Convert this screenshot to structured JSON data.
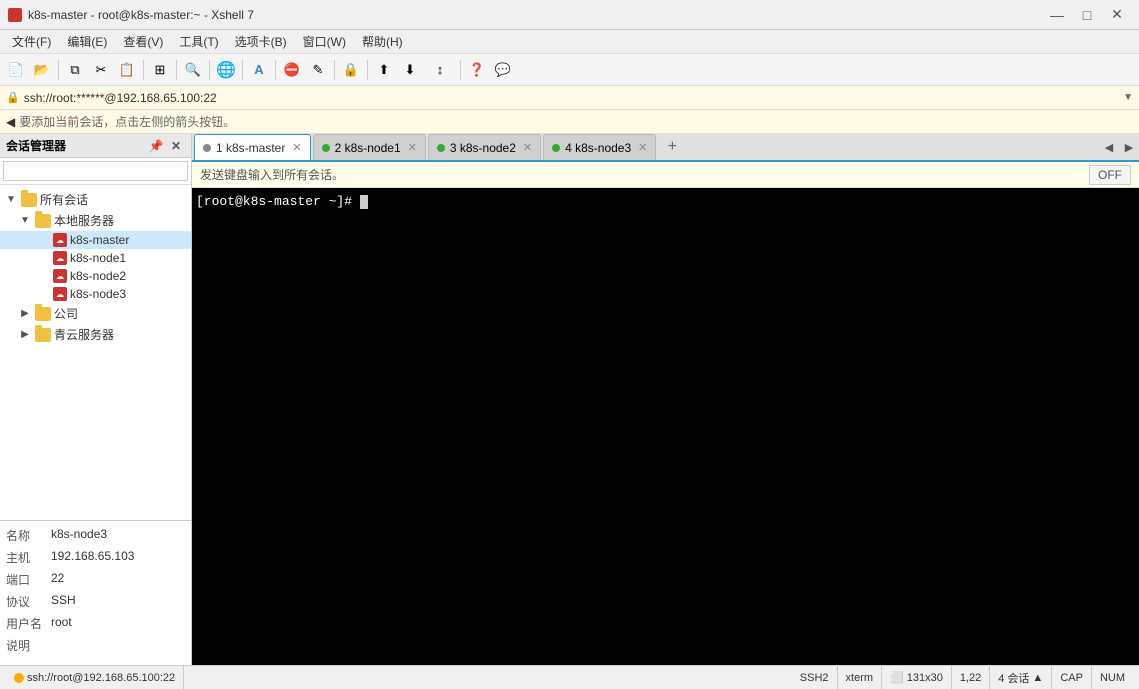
{
  "titlebar": {
    "icon_alt": "xshell-icon",
    "title": "k8s-master - root@k8s-master:~ - Xshell 7",
    "minimize": "—",
    "maximize": "□",
    "close": "✕"
  },
  "menubar": {
    "items": [
      "文件(F)",
      "编辑(E)",
      "查看(V)",
      "工具(T)",
      "选项卡(B)",
      "窗口(W)",
      "帮助(H)"
    ]
  },
  "addressbar": {
    "text": "ssh://root:******@192.168.65.100:22"
  },
  "noticebar": {
    "text": "要添加当前会话，点击左侧的箭头按钮。"
  },
  "sidebar": {
    "header": "会话管理器",
    "search_placeholder": "",
    "tree": {
      "root_label": "所有会话",
      "local_label": "本地服务器",
      "nodes": [
        {
          "label": "k8s-master",
          "active": true
        },
        {
          "label": "k8s-node1",
          "active": false
        },
        {
          "label": "k8s-node2",
          "active": false
        },
        {
          "label": "k8s-node3",
          "active": false
        }
      ],
      "groups": [
        {
          "label": "公司"
        },
        {
          "label": "青云服务器"
        }
      ]
    },
    "info": {
      "name_label": "名称",
      "name_value": "k8s-node3",
      "host_label": "主机",
      "host_value": "192.168.65.103",
      "port_label": "端口",
      "port_value": "22",
      "protocol_label": "协议",
      "protocol_value": "SSH",
      "username_label": "用户名",
      "username_value": "root",
      "note_label": "说明",
      "note_value": ""
    }
  },
  "tabs": [
    {
      "id": 1,
      "label": "1 k8s-master",
      "active": true,
      "dot_color": "grey"
    },
    {
      "id": 2,
      "label": "2 k8s-node1",
      "active": false,
      "dot_color": "green"
    },
    {
      "id": 3,
      "label": "3 k8s-node2",
      "active": false,
      "dot_color": "green"
    },
    {
      "id": 4,
      "label": "4 k8s-node3",
      "active": false,
      "dot_color": "green"
    }
  ],
  "broadcastbar": {
    "text": "发送键盘输入到所有会话。",
    "button_label": "OFF"
  },
  "terminal": {
    "prompt": "[root@k8s-master ~]# "
  },
  "statusbar": {
    "ssh_label": "SSH2",
    "term_label": "xterm",
    "size_label": "131x30",
    "cursor_pos": "1,22",
    "sessions_label": "4 会话",
    "cap_label": "CAP",
    "num_label": "NUM",
    "addr": "ssh://root@192.168.65.100:22"
  }
}
